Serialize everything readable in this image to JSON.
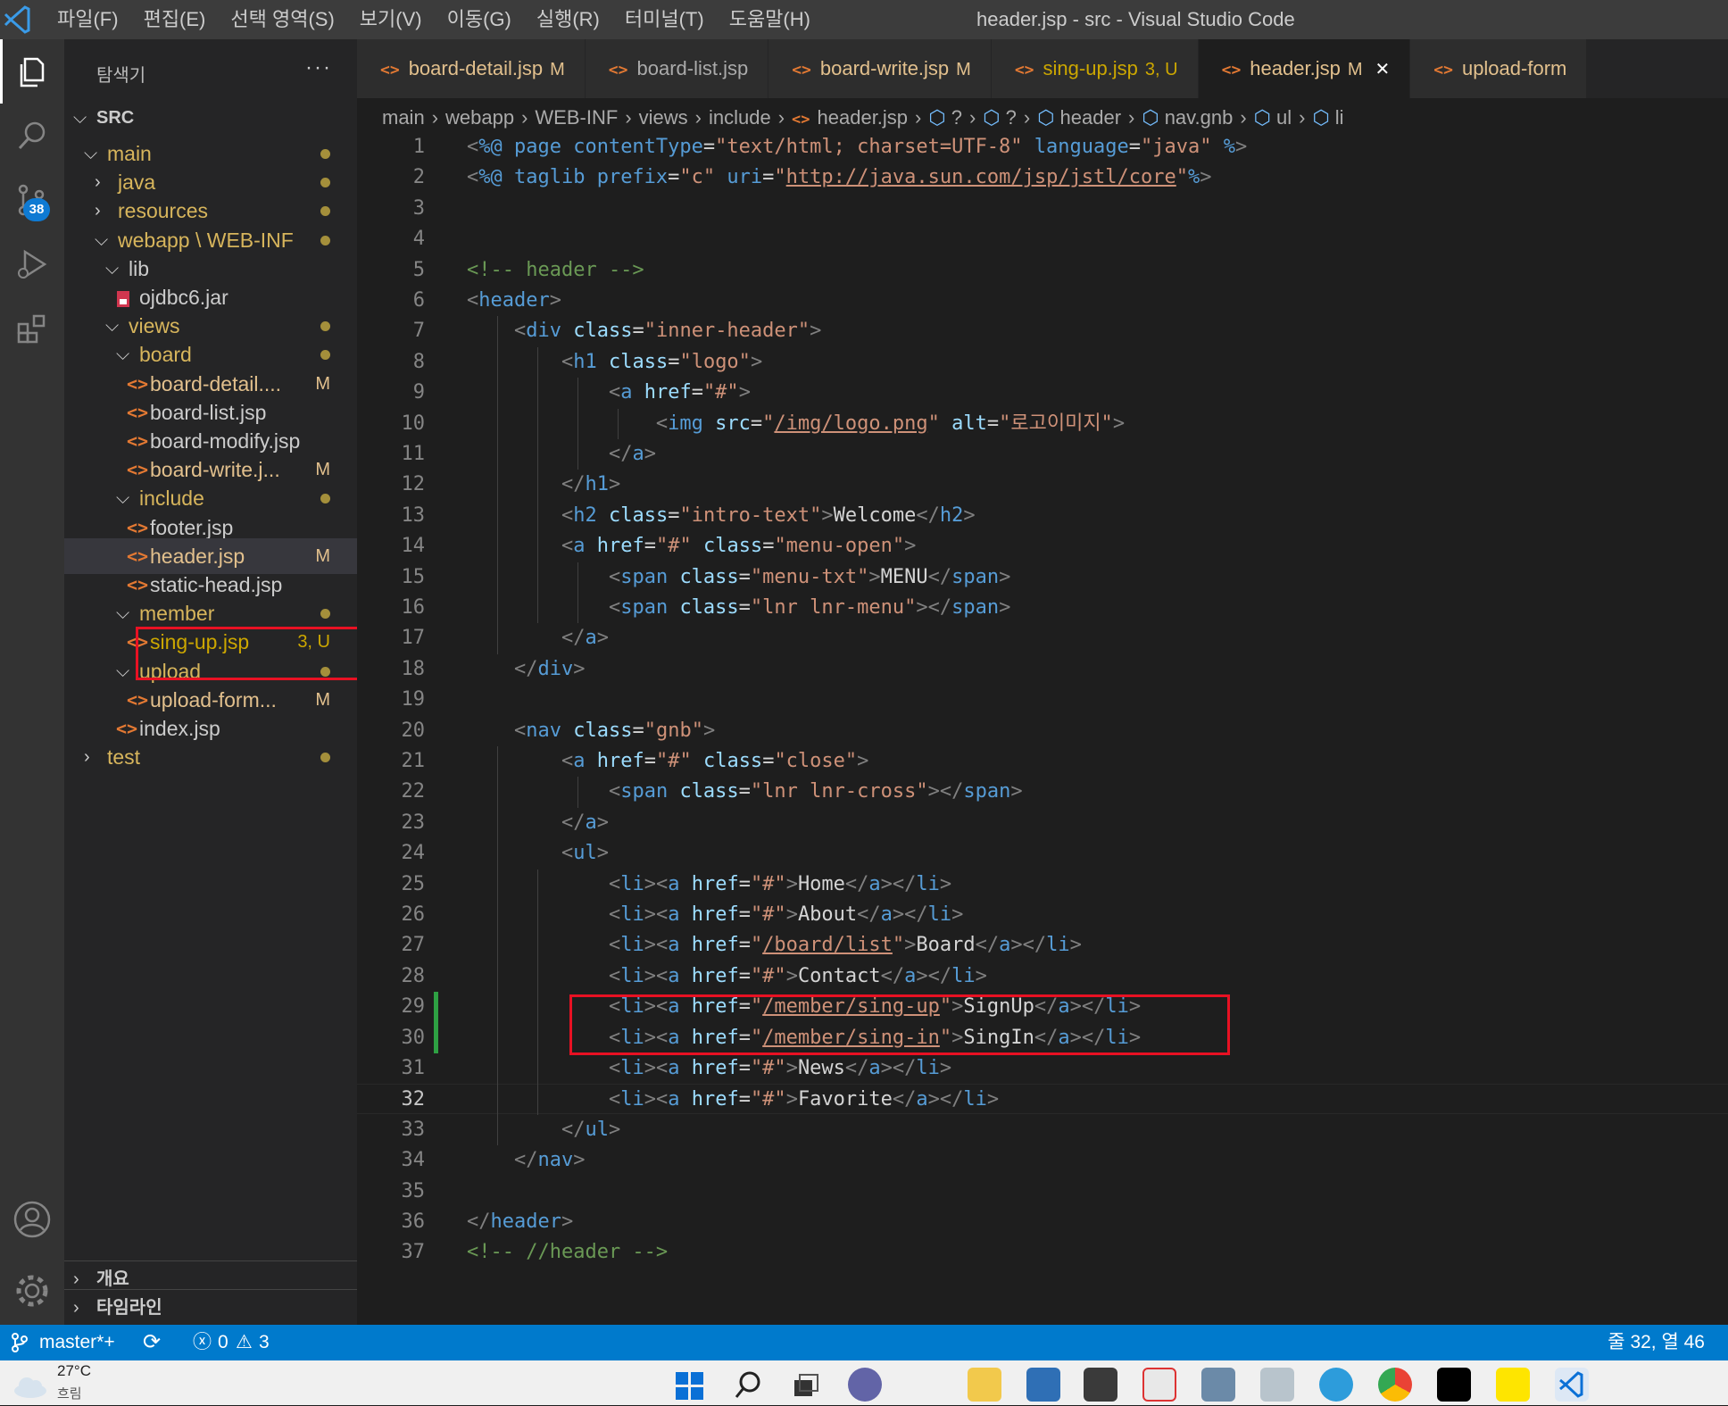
{
  "titlebar": {
    "menus": [
      "파일(F)",
      "편집(E)",
      "선택 영역(S)",
      "보기(V)",
      "이동(G)",
      "실행(R)",
      "터미널(T)",
      "도움말(H)"
    ],
    "window_title": "header.jsp - src - Visual Studio Code"
  },
  "activitybar": {
    "icons": [
      "explorer-icon",
      "search-icon",
      "source-control-icon",
      "run-debug-icon",
      "extensions-icon",
      "account-icon",
      "settings-gear-icon"
    ],
    "scm_badge": "38"
  },
  "sidebar": {
    "title": "탐색기",
    "more": "···",
    "root": "SRC",
    "tree": [
      {
        "label": "main",
        "type": "folder",
        "open": true,
        "depth": 1,
        "color": "mod",
        "dot": "#a48f3b"
      },
      {
        "label": "java",
        "type": "folder",
        "open": false,
        "depth": 2,
        "color": "mod",
        "dot": "#a48f3b"
      },
      {
        "label": "resources",
        "type": "folder",
        "open": false,
        "depth": 2,
        "color": "mod",
        "dot": "#a48f3b"
      },
      {
        "label": "webapp \\ WEB-INF",
        "type": "folder",
        "open": true,
        "depth": 2,
        "color": "mod",
        "dot": "#a48f3b"
      },
      {
        "label": "lib",
        "type": "folder",
        "open": true,
        "depth": 3,
        "color": "plain"
      },
      {
        "label": "ojdbc6.jar",
        "type": "jar",
        "depth": 4,
        "color": "plain"
      },
      {
        "label": "views",
        "type": "folder",
        "open": true,
        "depth": 3,
        "color": "mod",
        "dot": "#a48f3b"
      },
      {
        "label": "board",
        "type": "folder",
        "open": true,
        "depth": 4,
        "color": "mod",
        "dot": "#a48f3b"
      },
      {
        "label": "board-detail....",
        "type": "file",
        "depth": 5,
        "color": "mod",
        "badge": "M"
      },
      {
        "label": "board-list.jsp",
        "type": "file",
        "depth": 5,
        "color": "plain"
      },
      {
        "label": "board-modify.jsp",
        "type": "file",
        "depth": 5,
        "color": "plain"
      },
      {
        "label": "board-write.j...",
        "type": "file",
        "depth": 5,
        "color": "mod",
        "badge": "M"
      },
      {
        "label": "include",
        "type": "folder",
        "open": true,
        "depth": 4,
        "color": "mod",
        "dot": "#a48f3b"
      },
      {
        "label": "footer.jsp",
        "type": "file",
        "depth": 5,
        "color": "plain"
      },
      {
        "label": "header.jsp",
        "type": "file",
        "depth": 5,
        "color": "mod",
        "badge": "M",
        "selected": true
      },
      {
        "label": "static-head.jsp",
        "type": "file",
        "depth": 5,
        "color": "plain"
      },
      {
        "label": "member",
        "type": "folder",
        "open": true,
        "depth": 4,
        "color": "mod",
        "dot": "#a48f3b"
      },
      {
        "label": "sing-up.jsp",
        "type": "file",
        "depth": 5,
        "color": "mod",
        "badge": "3, U"
      },
      {
        "label": "upload",
        "type": "folder",
        "open": true,
        "depth": 4,
        "color": "mod",
        "dot": "#a48f3b"
      },
      {
        "label": "upload-form...",
        "type": "file",
        "depth": 5,
        "color": "mod",
        "badge": "M"
      },
      {
        "label": "index.jsp",
        "type": "file",
        "depth": 4,
        "color": "plain"
      },
      {
        "label": "test",
        "type": "folder",
        "open": false,
        "depth": 1,
        "color": "mod",
        "dot": "#a48f3b"
      }
    ],
    "outline": "개요",
    "timeline": "타임라인"
  },
  "tabs": [
    {
      "label": "board-detail.jsp",
      "badge": "M",
      "color": "#e2c08d"
    },
    {
      "label": "board-list.jsp",
      "badge": "",
      "color": "#aaaaaa"
    },
    {
      "label": "board-write.jsp",
      "badge": "M",
      "color": "#e2c08d"
    },
    {
      "label": "sing-up.jsp",
      "badge": "3, U",
      "color": "#cca700"
    },
    {
      "label": "header.jsp",
      "badge": "M",
      "color": "#e2c08d",
      "active": true
    },
    {
      "label": "upload-form",
      "badge": "",
      "color": "#e2c08d"
    }
  ],
  "breadcrumb": [
    "main",
    "webapp",
    "WEB-INF",
    "views",
    "include",
    "header.jsp",
    "?",
    "?",
    "header",
    "nav.gnb",
    "ul",
    "li"
  ],
  "code": [
    [
      [
        "br",
        "<"
      ],
      [
        "dir",
        "%@ page contentType"
      ],
      [
        "txt",
        "="
      ],
      [
        "str",
        "\"text/html; charset=UTF-8\""
      ],
      [
        "txt",
        " "
      ],
      [
        "dir",
        "language"
      ],
      [
        "txt",
        "="
      ],
      [
        "str",
        "\"java\""
      ],
      [
        "dir",
        " %"
      ],
      [
        "br",
        ">"
      ]
    ],
    [
      [
        "br",
        "<"
      ],
      [
        "dir",
        "%@ taglib prefix"
      ],
      [
        "txt",
        "="
      ],
      [
        "str",
        "\"c\""
      ],
      [
        "txt",
        " "
      ],
      [
        "dir",
        "uri"
      ],
      [
        "txt",
        "="
      ],
      [
        "str",
        "\""
      ],
      [
        "stru",
        "http://java.sun.com/jsp/jstl/core"
      ],
      [
        "str",
        "\""
      ],
      [
        "dir",
        "%"
      ],
      [
        "br",
        ">"
      ]
    ],
    [],
    [],
    [
      [
        "com",
        "<!-- header -->"
      ]
    ],
    [
      [
        "br",
        "<"
      ],
      [
        "tag",
        "header"
      ],
      [
        "br",
        ">"
      ]
    ],
    [
      [
        "txt",
        "    "
      ],
      [
        "br",
        "<"
      ],
      [
        "tag",
        "div"
      ],
      [
        "txt",
        " "
      ],
      [
        "attr",
        "class"
      ],
      [
        "txt",
        "="
      ],
      [
        "str",
        "\"inner-header\""
      ],
      [
        "br",
        ">"
      ]
    ],
    [
      [
        "txt",
        "        "
      ],
      [
        "br",
        "<"
      ],
      [
        "tag",
        "h1"
      ],
      [
        "txt",
        " "
      ],
      [
        "attr",
        "class"
      ],
      [
        "txt",
        "="
      ],
      [
        "str",
        "\"logo\""
      ],
      [
        "br",
        ">"
      ]
    ],
    [
      [
        "txt",
        "            "
      ],
      [
        "br",
        "<"
      ],
      [
        "tag",
        "a"
      ],
      [
        "txt",
        " "
      ],
      [
        "attr",
        "href"
      ],
      [
        "txt",
        "="
      ],
      [
        "str",
        "\"#\""
      ],
      [
        "br",
        ">"
      ]
    ],
    [
      [
        "txt",
        "                "
      ],
      [
        "br",
        "<"
      ],
      [
        "tag",
        "img"
      ],
      [
        "txt",
        " "
      ],
      [
        "attr",
        "src"
      ],
      [
        "txt",
        "="
      ],
      [
        "str",
        "\""
      ],
      [
        "stru",
        "/img/logo.png"
      ],
      [
        "str",
        "\""
      ],
      [
        "txt",
        " "
      ],
      [
        "attr",
        "alt"
      ],
      [
        "txt",
        "="
      ],
      [
        "str",
        "\"로고이미지\""
      ],
      [
        "br",
        ">"
      ]
    ],
    [
      [
        "txt",
        "            "
      ],
      [
        "br",
        "</"
      ],
      [
        "tag",
        "a"
      ],
      [
        "br",
        ">"
      ]
    ],
    [
      [
        "txt",
        "        "
      ],
      [
        "br",
        "</"
      ],
      [
        "tag",
        "h1"
      ],
      [
        "br",
        ">"
      ]
    ],
    [
      [
        "txt",
        "        "
      ],
      [
        "br",
        "<"
      ],
      [
        "tag",
        "h2"
      ],
      [
        "txt",
        " "
      ],
      [
        "attr",
        "class"
      ],
      [
        "txt",
        "="
      ],
      [
        "str",
        "\"intro-text\""
      ],
      [
        "br",
        ">"
      ],
      [
        "txt",
        "Welcome"
      ],
      [
        "br",
        "</"
      ],
      [
        "tag",
        "h2"
      ],
      [
        "br",
        ">"
      ]
    ],
    [
      [
        "txt",
        "        "
      ],
      [
        "br",
        "<"
      ],
      [
        "tag",
        "a"
      ],
      [
        "txt",
        " "
      ],
      [
        "attr",
        "href"
      ],
      [
        "txt",
        "="
      ],
      [
        "str",
        "\"#\""
      ],
      [
        "txt",
        " "
      ],
      [
        "attr",
        "class"
      ],
      [
        "txt",
        "="
      ],
      [
        "str",
        "\"menu-open\""
      ],
      [
        "br",
        ">"
      ]
    ],
    [
      [
        "txt",
        "            "
      ],
      [
        "br",
        "<"
      ],
      [
        "tag",
        "span"
      ],
      [
        "txt",
        " "
      ],
      [
        "attr",
        "class"
      ],
      [
        "txt",
        "="
      ],
      [
        "str",
        "\"menu-txt\""
      ],
      [
        "br",
        ">"
      ],
      [
        "txt",
        "MENU"
      ],
      [
        "br",
        "</"
      ],
      [
        "tag",
        "span"
      ],
      [
        "br",
        ">"
      ]
    ],
    [
      [
        "txt",
        "            "
      ],
      [
        "br",
        "<"
      ],
      [
        "tag",
        "span"
      ],
      [
        "txt",
        " "
      ],
      [
        "attr",
        "class"
      ],
      [
        "txt",
        "="
      ],
      [
        "str",
        "\"lnr lnr-menu\""
      ],
      [
        "br",
        "></"
      ],
      [
        "tag",
        "span"
      ],
      [
        "br",
        ">"
      ]
    ],
    [
      [
        "txt",
        "        "
      ],
      [
        "br",
        "</"
      ],
      [
        "tag",
        "a"
      ],
      [
        "br",
        ">"
      ]
    ],
    [
      [
        "txt",
        "    "
      ],
      [
        "br",
        "</"
      ],
      [
        "tag",
        "div"
      ],
      [
        "br",
        ">"
      ]
    ],
    [],
    [
      [
        "txt",
        "    "
      ],
      [
        "br",
        "<"
      ],
      [
        "tag",
        "nav"
      ],
      [
        "txt",
        " "
      ],
      [
        "attr",
        "class"
      ],
      [
        "txt",
        "="
      ],
      [
        "str",
        "\"gnb\""
      ],
      [
        "br",
        ">"
      ]
    ],
    [
      [
        "txt",
        "        "
      ],
      [
        "br",
        "<"
      ],
      [
        "tag",
        "a"
      ],
      [
        "txt",
        " "
      ],
      [
        "attr",
        "href"
      ],
      [
        "txt",
        "="
      ],
      [
        "str",
        "\"#\""
      ],
      [
        "txt",
        " "
      ],
      [
        "attr",
        "class"
      ],
      [
        "txt",
        "="
      ],
      [
        "str",
        "\"close\""
      ],
      [
        "br",
        ">"
      ]
    ],
    [
      [
        "txt",
        "            "
      ],
      [
        "br",
        "<"
      ],
      [
        "tag",
        "span"
      ],
      [
        "txt",
        " "
      ],
      [
        "attr",
        "class"
      ],
      [
        "txt",
        "="
      ],
      [
        "str",
        "\"lnr lnr-cross\""
      ],
      [
        "br",
        "></"
      ],
      [
        "tag",
        "span"
      ],
      [
        "br",
        ">"
      ]
    ],
    [
      [
        "txt",
        "        "
      ],
      [
        "br",
        "</"
      ],
      [
        "tag",
        "a"
      ],
      [
        "br",
        ">"
      ]
    ],
    [
      [
        "txt",
        "        "
      ],
      [
        "br",
        "<"
      ],
      [
        "tag",
        "ul"
      ],
      [
        "br",
        ">"
      ]
    ],
    [
      [
        "txt",
        "            "
      ],
      [
        "br",
        "<"
      ],
      [
        "tag",
        "li"
      ],
      [
        "br",
        "><"
      ],
      [
        "tag",
        "a"
      ],
      [
        "txt",
        " "
      ],
      [
        "attr",
        "href"
      ],
      [
        "txt",
        "="
      ],
      [
        "str",
        "\"#\""
      ],
      [
        "br",
        ">"
      ],
      [
        "txt",
        "Home"
      ],
      [
        "br",
        "</"
      ],
      [
        "tag",
        "a"
      ],
      [
        "br",
        "></"
      ],
      [
        "tag",
        "li"
      ],
      [
        "br",
        ">"
      ]
    ],
    [
      [
        "txt",
        "            "
      ],
      [
        "br",
        "<"
      ],
      [
        "tag",
        "li"
      ],
      [
        "br",
        "><"
      ],
      [
        "tag",
        "a"
      ],
      [
        "txt",
        " "
      ],
      [
        "attr",
        "href"
      ],
      [
        "txt",
        "="
      ],
      [
        "str",
        "\"#\""
      ],
      [
        "br",
        ">"
      ],
      [
        "txt",
        "About"
      ],
      [
        "br",
        "</"
      ],
      [
        "tag",
        "a"
      ],
      [
        "br",
        "></"
      ],
      [
        "tag",
        "li"
      ],
      [
        "br",
        ">"
      ]
    ],
    [
      [
        "txt",
        "            "
      ],
      [
        "br",
        "<"
      ],
      [
        "tag",
        "li"
      ],
      [
        "br",
        "><"
      ],
      [
        "tag",
        "a"
      ],
      [
        "txt",
        " "
      ],
      [
        "attr",
        "href"
      ],
      [
        "txt",
        "="
      ],
      [
        "str",
        "\""
      ],
      [
        "stru",
        "/board/list"
      ],
      [
        "str",
        "\""
      ],
      [
        "br",
        ">"
      ],
      [
        "txt",
        "Board"
      ],
      [
        "br",
        "</"
      ],
      [
        "tag",
        "a"
      ],
      [
        "br",
        "></"
      ],
      [
        "tag",
        "li"
      ],
      [
        "br",
        ">"
      ]
    ],
    [
      [
        "txt",
        "            "
      ],
      [
        "br",
        "<"
      ],
      [
        "tag",
        "li"
      ],
      [
        "br",
        "><"
      ],
      [
        "tag",
        "a"
      ],
      [
        "txt",
        " "
      ],
      [
        "attr",
        "href"
      ],
      [
        "txt",
        "="
      ],
      [
        "str",
        "\"#\""
      ],
      [
        "br",
        ">"
      ],
      [
        "txt",
        "Contact"
      ],
      [
        "br",
        "</"
      ],
      [
        "tag",
        "a"
      ],
      [
        "br",
        "></"
      ],
      [
        "tag",
        "li"
      ],
      [
        "br",
        ">"
      ]
    ],
    [
      [
        "txt",
        "            "
      ],
      [
        "br",
        "<"
      ],
      [
        "tag",
        "li"
      ],
      [
        "br",
        "><"
      ],
      [
        "tag",
        "a"
      ],
      [
        "txt",
        " "
      ],
      [
        "attr",
        "href"
      ],
      [
        "txt",
        "="
      ],
      [
        "str",
        "\""
      ],
      [
        "stru",
        "/member/sing-up"
      ],
      [
        "str",
        "\""
      ],
      [
        "br",
        ">"
      ],
      [
        "txt",
        "SignUp"
      ],
      [
        "br",
        "</"
      ],
      [
        "tag",
        "a"
      ],
      [
        "br",
        "></"
      ],
      [
        "tag",
        "li"
      ],
      [
        "br",
        ">"
      ]
    ],
    [
      [
        "txt",
        "            "
      ],
      [
        "br",
        "<"
      ],
      [
        "tag",
        "li"
      ],
      [
        "br",
        "><"
      ],
      [
        "tag",
        "a"
      ],
      [
        "txt",
        " "
      ],
      [
        "attr",
        "href"
      ],
      [
        "txt",
        "="
      ],
      [
        "str",
        "\""
      ],
      [
        "stru",
        "/member/sing-in"
      ],
      [
        "str",
        "\""
      ],
      [
        "br",
        ">"
      ],
      [
        "txt",
        "SingIn"
      ],
      [
        "br",
        "</"
      ],
      [
        "tag",
        "a"
      ],
      [
        "br",
        "></"
      ],
      [
        "tag",
        "li"
      ],
      [
        "br",
        ">"
      ]
    ],
    [
      [
        "txt",
        "            "
      ],
      [
        "br",
        "<"
      ],
      [
        "tag",
        "li"
      ],
      [
        "br",
        "><"
      ],
      [
        "tag",
        "a"
      ],
      [
        "txt",
        " "
      ],
      [
        "attr",
        "href"
      ],
      [
        "txt",
        "="
      ],
      [
        "str",
        "\"#\""
      ],
      [
        "br",
        ">"
      ],
      [
        "txt",
        "News"
      ],
      [
        "br",
        "</"
      ],
      [
        "tag",
        "a"
      ],
      [
        "br",
        "></"
      ],
      [
        "tag",
        "li"
      ],
      [
        "br",
        ">"
      ]
    ],
    [
      [
        "txt",
        "            "
      ],
      [
        "br",
        "<"
      ],
      [
        "tag",
        "li"
      ],
      [
        "br",
        "><"
      ],
      [
        "tag",
        "a"
      ],
      [
        "txt",
        " "
      ],
      [
        "attr",
        "href"
      ],
      [
        "txt",
        "="
      ],
      [
        "str",
        "\"#\""
      ],
      [
        "br",
        ">"
      ],
      [
        "txt",
        "Favorite"
      ],
      [
        "br",
        "</"
      ],
      [
        "tag",
        "a"
      ],
      [
        "br",
        "></"
      ],
      [
        "tag",
        "li"
      ],
      [
        "br",
        ">"
      ]
    ],
    [
      [
        "txt",
        "        "
      ],
      [
        "br",
        "</"
      ],
      [
        "tag",
        "ul"
      ],
      [
        "br",
        ">"
      ]
    ],
    [
      [
        "txt",
        "    "
      ],
      [
        "br",
        "</"
      ],
      [
        "tag",
        "nav"
      ],
      [
        "br",
        ">"
      ]
    ],
    [],
    [
      [
        "br",
        "</"
      ],
      [
        "tag",
        "header"
      ],
      [
        "br",
        ">"
      ]
    ],
    [
      [
        "com",
        "<!-- //header -->"
      ]
    ]
  ],
  "current_line": 32,
  "modified_lines": [
    29,
    30
  ],
  "statusbar": {
    "branch": "master*+",
    "errors": "0",
    "warnings": "3",
    "position": "줄 32, 열 46"
  },
  "taskbar": {
    "weather_temp": "27°C",
    "weather_desc": "흐림"
  },
  "colors": {
    "accent": "#007acc",
    "highlight_box": "#e81123",
    "modified": "#e2c08d",
    "jsp_icon": "#e37933"
  }
}
